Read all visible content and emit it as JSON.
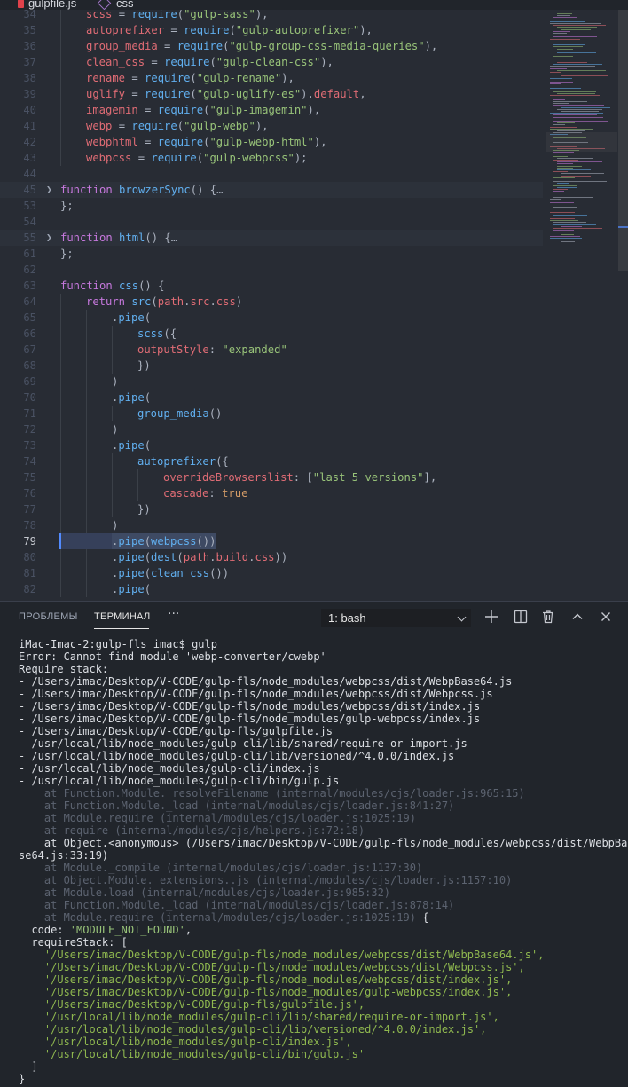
{
  "tabs": [
    {
      "label": "gulpfile.js",
      "icon": "gulp-icon"
    },
    {
      "label": "css",
      "icon": "css-icon"
    }
  ],
  "editor": {
    "lines": [
      {
        "n": "34",
        "ind": 1,
        "tokens": [
          [
            "vr",
            "scss"
          ],
          [
            "pl",
            " = "
          ],
          [
            "fn",
            "require"
          ],
          [
            "pl",
            "("
          ],
          [
            "st",
            "\"gulp-sass\""
          ],
          [
            "pl",
            "),"
          ]
        ]
      },
      {
        "n": "35",
        "ind": 1,
        "tokens": [
          [
            "vr",
            "autoprefixer"
          ],
          [
            "pl",
            " = "
          ],
          [
            "fn",
            "require"
          ],
          [
            "pl",
            "("
          ],
          [
            "st",
            "\"gulp-autoprefixer\""
          ],
          [
            "pl",
            "),"
          ]
        ]
      },
      {
        "n": "36",
        "ind": 1,
        "tokens": [
          [
            "vr",
            "group_media"
          ],
          [
            "pl",
            " = "
          ],
          [
            "fn",
            "require"
          ],
          [
            "pl",
            "("
          ],
          [
            "st",
            "\"gulp-group-css-media-queries\""
          ],
          [
            "pl",
            "),"
          ]
        ]
      },
      {
        "n": "37",
        "ind": 1,
        "tokens": [
          [
            "vr",
            "clean_css"
          ],
          [
            "pl",
            " = "
          ],
          [
            "fn",
            "require"
          ],
          [
            "pl",
            "("
          ],
          [
            "st",
            "\"gulp-clean-css\""
          ],
          [
            "pl",
            "),"
          ]
        ]
      },
      {
        "n": "38",
        "ind": 1,
        "tokens": [
          [
            "vr",
            "rename"
          ],
          [
            "pl",
            " = "
          ],
          [
            "fn",
            "require"
          ],
          [
            "pl",
            "("
          ],
          [
            "st",
            "\"gulp-rename\""
          ],
          [
            "pl",
            "),"
          ]
        ]
      },
      {
        "n": "39",
        "ind": 1,
        "tokens": [
          [
            "vr",
            "uglify"
          ],
          [
            "pl",
            " = "
          ],
          [
            "fn",
            "require"
          ],
          [
            "pl",
            "("
          ],
          [
            "st",
            "\"gulp-uglify-es\""
          ],
          [
            "pl",
            ")."
          ],
          [
            "vr",
            "default"
          ],
          [
            "pl",
            ","
          ]
        ]
      },
      {
        "n": "40",
        "ind": 1,
        "tokens": [
          [
            "vr",
            "imagemin"
          ],
          [
            "pl",
            " = "
          ],
          [
            "fn",
            "require"
          ],
          [
            "pl",
            "("
          ],
          [
            "st",
            "\"gulp-imagemin\""
          ],
          [
            "pl",
            "),"
          ]
        ]
      },
      {
        "n": "41",
        "ind": 1,
        "tokens": [
          [
            "vr",
            "webp"
          ],
          [
            "pl",
            " = "
          ],
          [
            "fn",
            "require"
          ],
          [
            "pl",
            "("
          ],
          [
            "st",
            "\"gulp-webp\""
          ],
          [
            "pl",
            "),"
          ]
        ]
      },
      {
        "n": "42",
        "ind": 1,
        "tokens": [
          [
            "vr",
            "webphtml"
          ],
          [
            "pl",
            " = "
          ],
          [
            "fn",
            "require"
          ],
          [
            "pl",
            "("
          ],
          [
            "st",
            "\"gulp-webp-html\""
          ],
          [
            "pl",
            "),"
          ]
        ]
      },
      {
        "n": "43",
        "ind": 1,
        "tokens": [
          [
            "vr",
            "webpcss"
          ],
          [
            "pl",
            " = "
          ],
          [
            "fn",
            "require"
          ],
          [
            "pl",
            "("
          ],
          [
            "st",
            "\"gulp-webpcss\""
          ],
          [
            "pl",
            ");"
          ]
        ]
      },
      {
        "n": "44",
        "ind": 0,
        "tokens": []
      },
      {
        "n": "45",
        "ind": 0,
        "fold": true,
        "tokens": [
          [
            "kw",
            "function"
          ],
          [
            "pl",
            " "
          ],
          [
            "fn",
            "browzerSync"
          ],
          [
            "pl",
            "() {"
          ],
          [
            "pl",
            "…"
          ]
        ]
      },
      {
        "n": "53",
        "ind": 0,
        "tokens": [
          [
            "pl",
            "};"
          ]
        ]
      },
      {
        "n": "54",
        "ind": 0,
        "tokens": []
      },
      {
        "n": "55",
        "ind": 0,
        "fold": true,
        "tokens": [
          [
            "kw",
            "function"
          ],
          [
            "pl",
            " "
          ],
          [
            "fn",
            "html"
          ],
          [
            "pl",
            "() {"
          ],
          [
            "pl",
            "…"
          ]
        ]
      },
      {
        "n": "61",
        "ind": 0,
        "tokens": [
          [
            "pl",
            "};"
          ]
        ]
      },
      {
        "n": "62",
        "ind": 0,
        "tokens": []
      },
      {
        "n": "63",
        "ind": 0,
        "tokens": [
          [
            "kw",
            "function"
          ],
          [
            "pl",
            " "
          ],
          [
            "fn",
            "css"
          ],
          [
            "pl",
            "() {"
          ]
        ]
      },
      {
        "n": "64",
        "ind": 1,
        "tokens": [
          [
            "kw",
            "return"
          ],
          [
            "pl",
            " "
          ],
          [
            "fn",
            "src"
          ],
          [
            "pl",
            "("
          ],
          [
            "vr",
            "path"
          ],
          [
            "pl",
            "."
          ],
          [
            "vr",
            "src"
          ],
          [
            "pl",
            "."
          ],
          [
            "vr",
            "css"
          ],
          [
            "pl",
            ")"
          ]
        ]
      },
      {
        "n": "65",
        "ind": 2,
        "tokens": [
          [
            "pl",
            "."
          ],
          [
            "fn",
            "pipe"
          ],
          [
            "pl",
            "("
          ]
        ]
      },
      {
        "n": "66",
        "ind": 3,
        "tokens": [
          [
            "fn",
            "scss"
          ],
          [
            "pl",
            "({"
          ]
        ]
      },
      {
        "n": "67",
        "ind": 3,
        "tokens": [
          [
            "vr",
            "outputStyle"
          ],
          [
            "pl",
            ": "
          ],
          [
            "st",
            "\"expanded\""
          ]
        ]
      },
      {
        "n": "68",
        "ind": 3,
        "tokens": [
          [
            "pl",
            "})"
          ]
        ]
      },
      {
        "n": "69",
        "ind": 2,
        "tokens": [
          [
            "pl",
            ")"
          ]
        ]
      },
      {
        "n": "70",
        "ind": 2,
        "tokens": [
          [
            "pl",
            "."
          ],
          [
            "fn",
            "pipe"
          ],
          [
            "pl",
            "("
          ]
        ]
      },
      {
        "n": "71",
        "ind": 3,
        "tokens": [
          [
            "fn",
            "group_media"
          ],
          [
            "pl",
            "()"
          ]
        ]
      },
      {
        "n": "72",
        "ind": 2,
        "tokens": [
          [
            "pl",
            ")"
          ]
        ]
      },
      {
        "n": "73",
        "ind": 2,
        "tokens": [
          [
            "pl",
            "."
          ],
          [
            "fn",
            "pipe"
          ],
          [
            "pl",
            "("
          ]
        ]
      },
      {
        "n": "74",
        "ind": 3,
        "tokens": [
          [
            "fn",
            "autoprefixer"
          ],
          [
            "pl",
            "({"
          ]
        ]
      },
      {
        "n": "75",
        "ind": 4,
        "tokens": [
          [
            "vr",
            "overrideBrowserslist"
          ],
          [
            "pl",
            ": ["
          ],
          [
            "st",
            "\"last 5 versions\""
          ],
          [
            "pl",
            "],"
          ]
        ]
      },
      {
        "n": "76",
        "ind": 4,
        "tokens": [
          [
            "vr",
            "cascade"
          ],
          [
            "pl",
            ": "
          ],
          [
            "nm",
            "true"
          ]
        ]
      },
      {
        "n": "77",
        "ind": 3,
        "tokens": [
          [
            "pl",
            "})"
          ]
        ]
      },
      {
        "n": "78",
        "ind": 2,
        "tokens": [
          [
            "pl",
            ")"
          ]
        ]
      },
      {
        "n": "79",
        "ind": 2,
        "active": true,
        "tokens": [
          [
            "pl",
            "."
          ],
          [
            "fn",
            "pipe"
          ],
          [
            "pl",
            "("
          ],
          [
            "fn",
            "webpcss"
          ],
          [
            "pl",
            "())"
          ]
        ]
      },
      {
        "n": "80",
        "ind": 2,
        "tokens": [
          [
            "pl",
            "."
          ],
          [
            "fn",
            "pipe"
          ],
          [
            "pl",
            "("
          ],
          [
            "fn",
            "dest"
          ],
          [
            "pl",
            "("
          ],
          [
            "vr",
            "path"
          ],
          [
            "pl",
            "."
          ],
          [
            "vr",
            "build"
          ],
          [
            "pl",
            "."
          ],
          [
            "vr",
            "css"
          ],
          [
            "pl",
            "))"
          ]
        ]
      },
      {
        "n": "81",
        "ind": 2,
        "tokens": [
          [
            "pl",
            "."
          ],
          [
            "fn",
            "pipe"
          ],
          [
            "pl",
            "("
          ],
          [
            "fn",
            "clean_css"
          ],
          [
            "pl",
            "())"
          ]
        ]
      },
      {
        "n": "82",
        "ind": 2,
        "tokens": [
          [
            "pl",
            "."
          ],
          [
            "fn",
            "pipe"
          ],
          [
            "pl",
            "("
          ]
        ]
      }
    ]
  },
  "panel": {
    "tab_problems": "ПРОБЛЕМЫ",
    "tab_terminal": "ТЕРМИНАЛ",
    "more": "···",
    "shell_selected": "1: bash",
    "actions": [
      "plus-icon",
      "split-icon",
      "trash-icon",
      "chevron-up-icon",
      "close-icon"
    ]
  },
  "terminal": {
    "lines": [
      {
        "c": "",
        "t": "iMac-Imac-2:gulp-fls imac$ gulp"
      },
      {
        "c": "",
        "t": "Error: Cannot find module 'webp-converter/cwebp'"
      },
      {
        "c": "",
        "t": "Require stack:"
      },
      {
        "c": "",
        "t": "- /Users/imac/Desktop/V-CODE/gulp-fls/node_modules/webpcss/dist/WebpBase64.js"
      },
      {
        "c": "",
        "t": "- /Users/imac/Desktop/V-CODE/gulp-fls/node_modules/webpcss/dist/Webpcss.js"
      },
      {
        "c": "",
        "t": "- /Users/imac/Desktop/V-CODE/gulp-fls/node_modules/webpcss/dist/index.js"
      },
      {
        "c": "",
        "t": "- /Users/imac/Desktop/V-CODE/gulp-fls/node_modules/gulp-webpcss/index.js"
      },
      {
        "c": "",
        "t": "- /Users/imac/Desktop/V-CODE/gulp-fls/gulpfile.js"
      },
      {
        "c": "",
        "t": "- /usr/local/lib/node_modules/gulp-cli/lib/shared/require-or-import.js"
      },
      {
        "c": "",
        "t": "- /usr/local/lib/node_modules/gulp-cli/lib/versioned/^4.0.0/index.js"
      },
      {
        "c": "",
        "t": "- /usr/local/lib/node_modules/gulp-cli/index.js"
      },
      {
        "c": "",
        "t": "- /usr/local/lib/node_modules/gulp-cli/bin/gulp.js"
      },
      {
        "c": "dim",
        "t": "    at Function.Module._resolveFilename (internal/modules/cjs/loader.js:965:15)"
      },
      {
        "c": "dim",
        "t": "    at Function.Module._load (internal/modules/cjs/loader.js:841:27)"
      },
      {
        "c": "dim",
        "t": "    at Module.require (internal/modules/cjs/loader.js:1025:19)"
      },
      {
        "c": "dim",
        "t": "    at require (internal/modules/cjs/helpers.js:72:18)"
      },
      {
        "c": "",
        "t": "    at Object.<anonymous> (/Users/imac/Desktop/V-CODE/gulp-fls/node_modules/webpcss/dist/WebpBa"
      },
      {
        "c": "",
        "t": "se64.js:33:19)"
      },
      {
        "c": "dim",
        "t": "    at Module._compile (internal/modules/cjs/loader.js:1137:30)"
      },
      {
        "c": "dim",
        "t": "    at Object.Module._extensions..js (internal/modules/cjs/loader.js:1157:10)"
      },
      {
        "c": "dim",
        "t": "    at Module.load (internal/modules/cjs/loader.js:985:32)"
      },
      {
        "c": "dim",
        "t": "    at Function.Module._load (internal/modules/cjs/loader.js:878:14)"
      },
      {
        "c": "dimmix",
        "t": "    at Module.require (internal/modules/cjs/loader.js:1025:19)",
        "tail": " {"
      },
      {
        "c": "code",
        "t": "  code: ",
        "val": "'MODULE_NOT_FOUND'",
        "tail": ","
      },
      {
        "c": "",
        "t": "  requireStack: ["
      },
      {
        "c": "grn",
        "t": "    '/Users/imac/Desktop/V-CODE/gulp-fls/node_modules/webpcss/dist/WebpBase64.js',"
      },
      {
        "c": "grn",
        "t": "    '/Users/imac/Desktop/V-CODE/gulp-fls/node_modules/webpcss/dist/Webpcss.js',"
      },
      {
        "c": "grn",
        "t": "    '/Users/imac/Desktop/V-CODE/gulp-fls/node_modules/webpcss/dist/index.js',"
      },
      {
        "c": "grn",
        "t": "    '/Users/imac/Desktop/V-CODE/gulp-fls/node_modules/gulp-webpcss/index.js',"
      },
      {
        "c": "grn",
        "t": "    '/Users/imac/Desktop/V-CODE/gulp-fls/gulpfile.js',"
      },
      {
        "c": "grn",
        "t": "    '/usr/local/lib/node_modules/gulp-cli/lib/shared/require-or-import.js',"
      },
      {
        "c": "grn",
        "t": "    '/usr/local/lib/node_modules/gulp-cli/lib/versioned/^4.0.0/index.js',"
      },
      {
        "c": "grn",
        "t": "    '/usr/local/lib/node_modules/gulp-cli/index.js',"
      },
      {
        "c": "grn",
        "t": "    '/usr/local/lib/node_modules/gulp-cli/bin/gulp.js'"
      },
      {
        "c": "",
        "t": "  ]"
      },
      {
        "c": "",
        "t": "}"
      }
    ]
  },
  "colors": {
    "editor_bg": "#282c34",
    "panel_bg": "#21252b",
    "keyword": "#c678dd",
    "function": "#61afef",
    "variable": "#e06c75",
    "string": "#98c379",
    "number": "#d19a66",
    "accent": "#528bff"
  }
}
